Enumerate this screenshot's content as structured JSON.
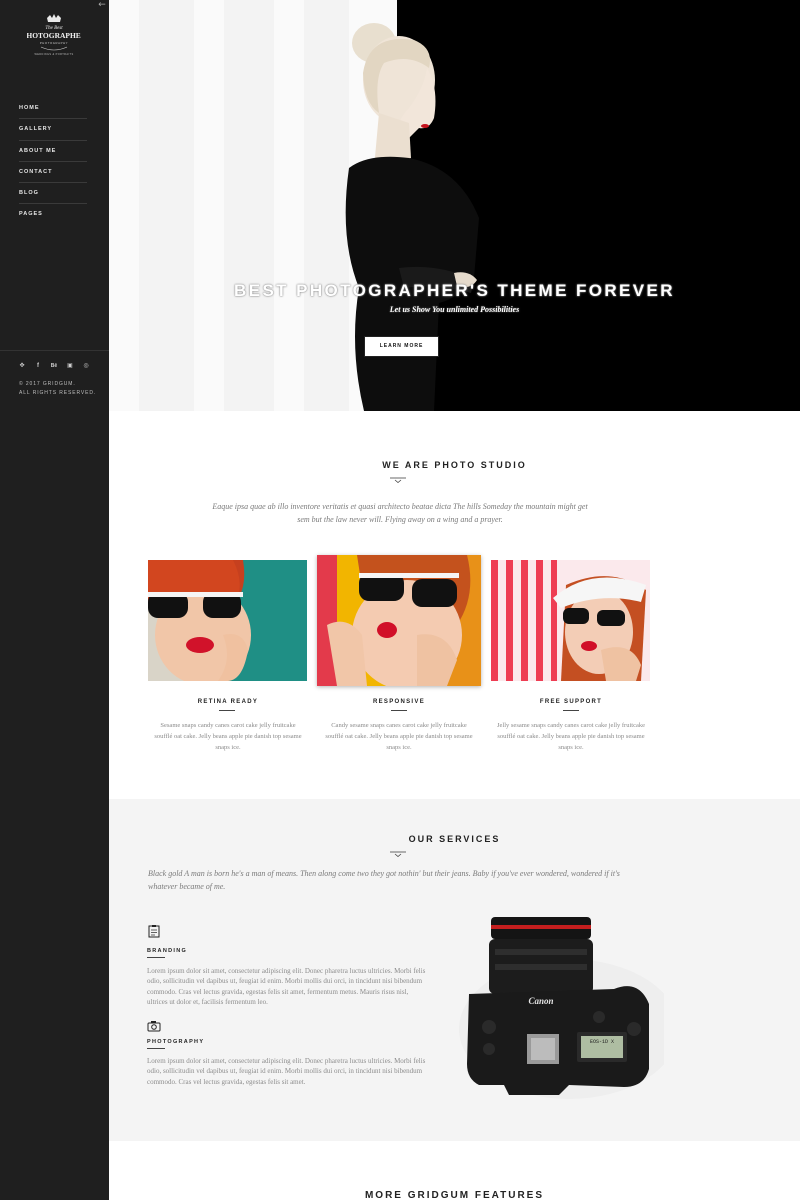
{
  "sidebar": {
    "logo_text": [
      "The Best",
      "PHOTOGRAPHER",
      "PHOTOGRAPHY",
      "WEDDINGS & PORTRAITS"
    ],
    "nav": [
      "HOME",
      "GALLERY",
      "ABOUT ME",
      "CONTACT",
      "BLOG",
      "PAGES"
    ],
    "social_icons": [
      "twitter-icon",
      "facebook-icon",
      "behance-icon",
      "flickr-icon",
      "dribbble-icon"
    ],
    "copyright_line1": "© 2017 GRIDGUM.",
    "copyright_line2": "ALL RIGHTS RESERVED."
  },
  "hero": {
    "title": "BEST PHOTOGRAPHER'S THEME FOREVER",
    "subtitle": "Let us Show You unlimited Possibilities",
    "button": "LEARN MORE"
  },
  "studio": {
    "title": "WE ARE PHOTO STUDIO",
    "intro": "Eaque ipsa quae ab illo inventore veritatis et quasi architecto beatae dicta The hills Someday the mountain might get sem but the law never will. Flying away on a wing and a prayer.",
    "cards": [
      {
        "title": "RETINA READY",
        "text": "Sesame snaps candy canes carot cake jelly fruitcake soufflé oat cake. Jelly beans apple pie danish top sesame snaps ice."
      },
      {
        "title": "RESPONSIVE",
        "text": "Candy sesame snaps canes carot cake jelly fruitcake soufflé oat cake. Jelly beans apple pie danish top sesame snaps ice."
      },
      {
        "title": "FREE SUPPORT",
        "text": "Jelly sesame snaps candy canes carot cake jelly fruitcake soufflé oat cake. Jelly beans apple pie danish top sesame snaps ice."
      }
    ]
  },
  "services": {
    "title": "OUR SERVICES",
    "intro": "Black gold A man is born he's a man of means. Then along come two they got nothin' but their jeans. Baby if you've ever wondered, wondered if it's whatever became of me.",
    "items": [
      {
        "label": "BRANDING",
        "icon": "clipboard-icon",
        "text": "Lorem ipsum dolor sit amet, consectetur adipiscing elit. Donec pharetra luctus ultricies. Morbi felis odio, sollicitudin vel dapibus ut, feugiat id enim. Morbi mollis dui orci, in tincidunt nisi bibendum commodo. Cras vel lectus gravida, egestas felis sit amet, fermentum metus. Mauris risus nisl, ultrices ut dolor et, facilisis fermentum leo."
      },
      {
        "label": "PHOTOGRAPHY",
        "icon": "camera-icon",
        "text": "Lorem ipsum dolor sit amet, consectetur adipiscing elit. Donec pharetra luctus ultricies. Morbi felis odio, sollicitudin vel dapibus ut, feugiat id enim. Morbi mollis dui orci, in tincidunt nisi bibendum commodo. Cras vel lectus gravida, egestas felis sit amet."
      }
    ],
    "camera_brand": "Canon",
    "camera_model": "EOS-1D X"
  },
  "features": {
    "title": "MORE GRIDGUM FEATURES"
  }
}
